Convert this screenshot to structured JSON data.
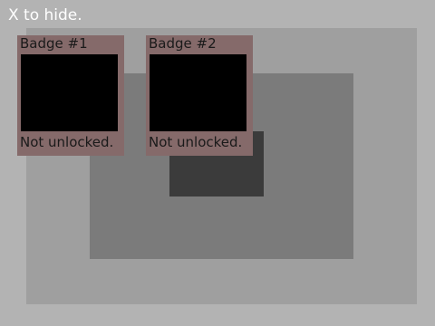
{
  "hint": {
    "text": "X to hide."
  },
  "badges": [
    {
      "title": "Badge #1",
      "status": "Not unlocked."
    },
    {
      "title": "Badge #2",
      "status": "Not unlocked."
    }
  ],
  "colors": {
    "background": "#b3b3b3",
    "panel_outer": "#9f9f9f",
    "panel_inner": "#7b7b7b",
    "panel_dark": "#3b3b3b",
    "badge_frame": "#856a6a",
    "badge_image": "#000000",
    "hint_text": "#ffffff",
    "badge_text": "#1a1a1a"
  }
}
